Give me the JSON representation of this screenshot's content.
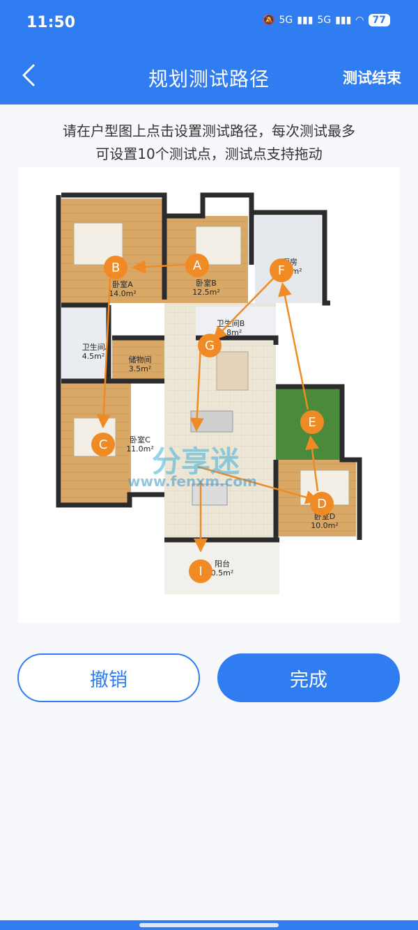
{
  "status": {
    "time": "11:50",
    "signal1": "5G",
    "signal2": "5G",
    "battery": "77"
  },
  "nav": {
    "title": "规划测试路径",
    "end_label": "测试结束"
  },
  "tip": {
    "line1": "请在户型图上点击设置测试路径，每次测试最多",
    "line2": "可设置10个测试点，测试点支持拖动"
  },
  "rooms": {
    "bedroom_a": {
      "name": "卧室A",
      "area": "14.0m²"
    },
    "bedroom_b": {
      "name": "卧室B",
      "area": "12.5m²"
    },
    "kitchen": {
      "name": "厨房",
      "area": "m²"
    },
    "bath_a": {
      "name": "卫生间A",
      "area": "4.5m²"
    },
    "storage": {
      "name": "储物间",
      "area": "3.5m²"
    },
    "bath_b": {
      "name": "卫生间B",
      "area": "3.8m²"
    },
    "bedroom_c": {
      "name": "卧室C",
      "area": "11.0m²"
    },
    "bedroom_d": {
      "name": "卧室D",
      "area": "10.0m²"
    },
    "balcony": {
      "name": "阳台",
      "area": "0.5m²"
    }
  },
  "points": [
    "A",
    "B",
    "C",
    "D",
    "E",
    "F",
    "G",
    "I"
  ],
  "watermark": {
    "text": "分享迷",
    "url": "www.fenxm.com"
  },
  "buttons": {
    "undo": "撤销",
    "done": "完成"
  },
  "colors": {
    "primary": "#2f7df0",
    "point": "#f08a24"
  }
}
